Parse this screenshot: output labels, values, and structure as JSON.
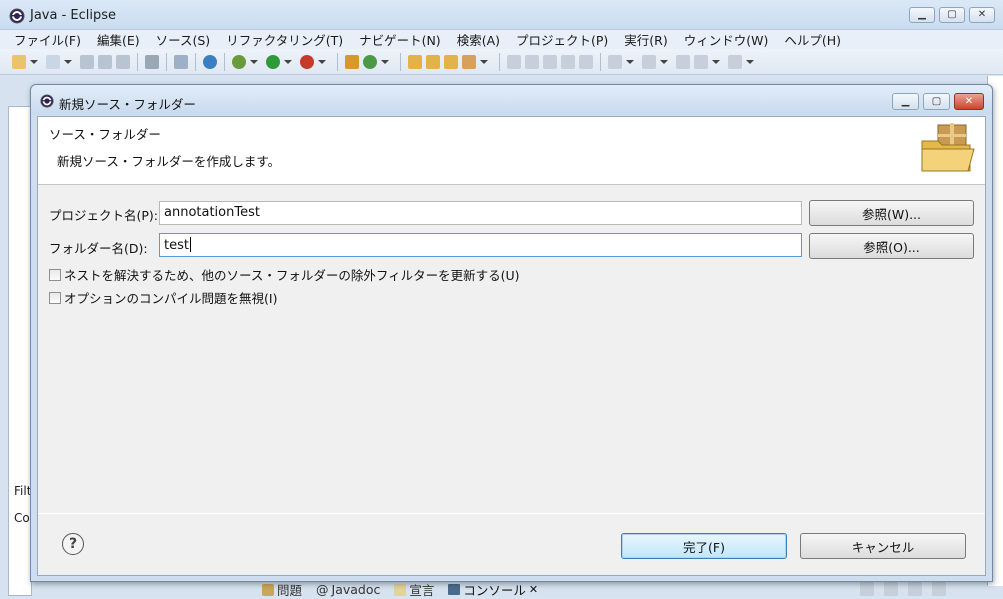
{
  "window": {
    "title": "Java - Eclipse",
    "minimize": "▁",
    "maximize": "▢",
    "close": "✕"
  },
  "menu": [
    "ファイル(F)",
    "編集(E)",
    "ソース(S)",
    "リファクタリング(T)",
    "ナビゲート(N)",
    "検索(A)",
    "プロジェクト(P)",
    "実行(R)",
    "ウィンドウ(W)",
    "ヘルプ(H)"
  ],
  "workbench": {
    "left_partial": [
      "Filt",
      "Co"
    ],
    "bottom_tabs": [
      "問題",
      "Javadoc",
      "宣言",
      "コンソール"
    ],
    "bottom_tab_icons": [
      "problems-icon",
      "javadoc-icon",
      "declaration-icon",
      "console-icon"
    ]
  },
  "dialog": {
    "title": "新規ソース・フォルダー",
    "banner_title": "ソース・フォルダー",
    "banner_description": "新規ソース・フォルダーを作成します。",
    "project_label": "プロジェクト名(P):",
    "project_value": "annotationTest",
    "project_browse": "参照(W)...",
    "folder_label": "フォルダー名(D):",
    "folder_value": "test",
    "folder_browse": "参照(O)...",
    "checkbox_update_exclusion": "ネストを解決するため、他のソース・フォルダーの除外フィルターを更新する(U)",
    "checkbox_update_exclusion_checked": false,
    "checkbox_ignore_problems": "オプションのコンパイル問題を無視(I)",
    "checkbox_ignore_problems_checked": false,
    "help": "?",
    "finish": "完了(F)",
    "cancel": "キャンセル"
  }
}
